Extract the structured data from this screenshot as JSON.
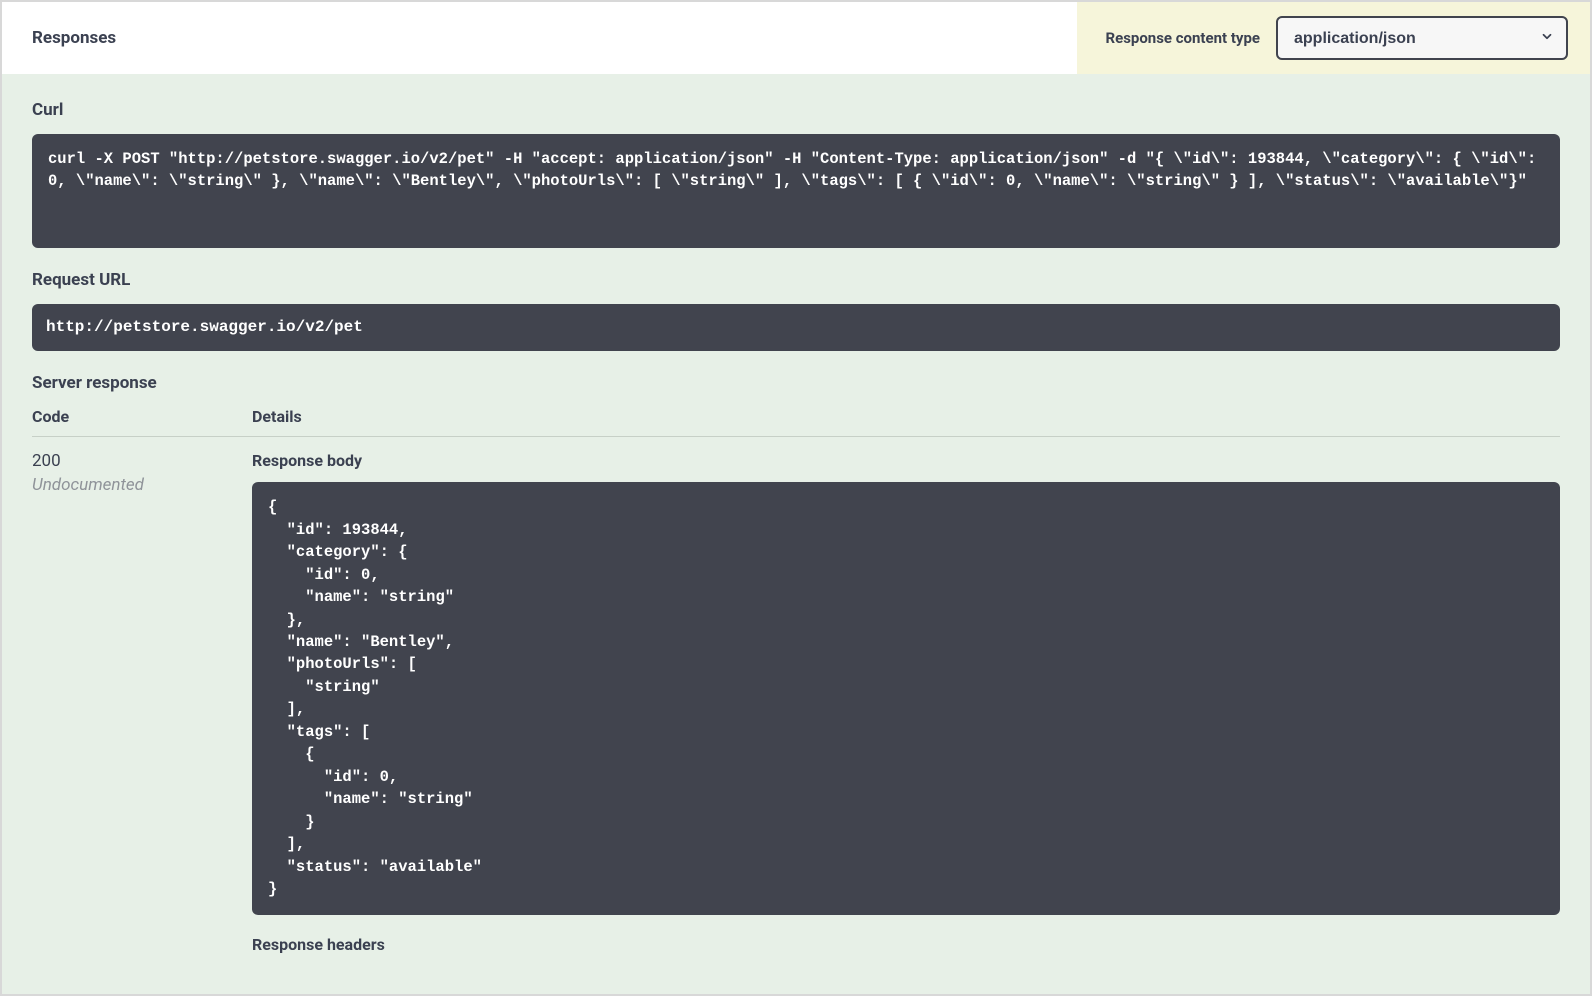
{
  "header": {
    "title": "Responses",
    "content_type_label": "Response content type",
    "content_type_value": "application/json"
  },
  "sections": {
    "curl_label": "Curl",
    "curl_command": "curl -X POST \"http://petstore.swagger.io/v2/pet\" -H \"accept: application/json\" -H \"Content-Type: application/json\" -d \"{ \\\"id\\\": 193844, \\\"category\\\": { \\\"id\\\": 0, \\\"name\\\": \\\"string\\\" }, \\\"name\\\": \\\"Bentley\\\", \\\"photoUrls\\\": [ \\\"string\\\" ], \\\"tags\\\": [ { \\\"id\\\": 0, \\\"name\\\": \\\"string\\\" } ], \\\"status\\\": \\\"available\\\"}\"",
    "request_url_label": "Request URL",
    "request_url_value": "http://petstore.swagger.io/v2/pet",
    "server_response_label": "Server response",
    "code_head": "Code",
    "details_head": "Details",
    "response_headers_label": "Response headers"
  },
  "response": {
    "code": "200",
    "undocumented": "Undocumented",
    "body_label": "Response body",
    "body_text": "{\n  \"id\": 193844,\n  \"category\": {\n    \"id\": 0,\n    \"name\": \"string\"\n  },\n  \"name\": \"Bentley\",\n  \"photoUrls\": [\n    \"string\"\n  ],\n  \"tags\": [\n    {\n      \"id\": 0,\n      \"name\": \"string\"\n    }\n  ],\n  \"status\": \"available\"\n}"
  }
}
